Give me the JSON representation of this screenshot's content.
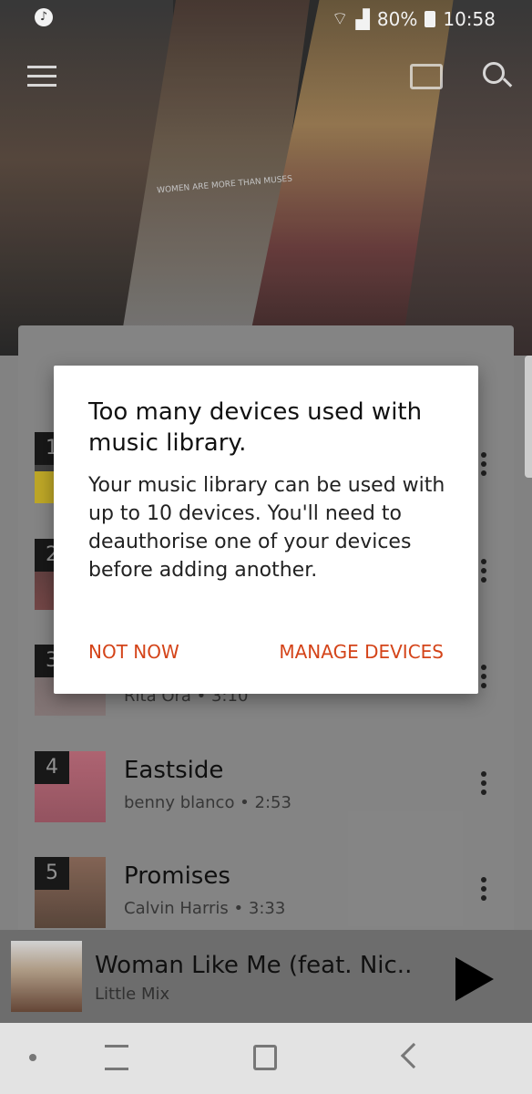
{
  "statusbar": {
    "app_icon": "music-note-icon",
    "battery_pct": "80%",
    "time": "10:58",
    "icons": [
      "wifi-icon",
      "signal-icon",
      "battery-icon"
    ]
  },
  "header_icons": [
    "menu-icon",
    "cast-icon",
    "search-icon"
  ],
  "hero": {
    "shirt_text": "WOMEN ARE MORE THAN MUSES"
  },
  "tracks": [
    {
      "rank": "1",
      "title": "",
      "subtitle": ""
    },
    {
      "rank": "2",
      "title": "",
      "subtitle": ""
    },
    {
      "rank": "3",
      "title": "",
      "subtitle": "Rita Ora • 3:10"
    },
    {
      "rank": "4",
      "title": "Eastside",
      "subtitle": "benny blanco • 2:53"
    },
    {
      "rank": "5",
      "title": "Promises",
      "subtitle": "Calvin Harris • 3:33"
    }
  ],
  "now_playing": {
    "title": "Woman Like Me (feat. Nic..",
    "artist": "Little Mix"
  },
  "dialog": {
    "title": "Too many devices used with music library.",
    "body": "Your music library can be used with up to 10 devices. You'll need to deauthorise one of your devices before adding another.",
    "cancel_label": "NOT NOW",
    "confirm_label": "MANAGE DEVICES"
  },
  "colors": {
    "accent": "#d44419",
    "dialog_bg": "#ffffff",
    "navbar_bg": "#e3e3e3"
  }
}
